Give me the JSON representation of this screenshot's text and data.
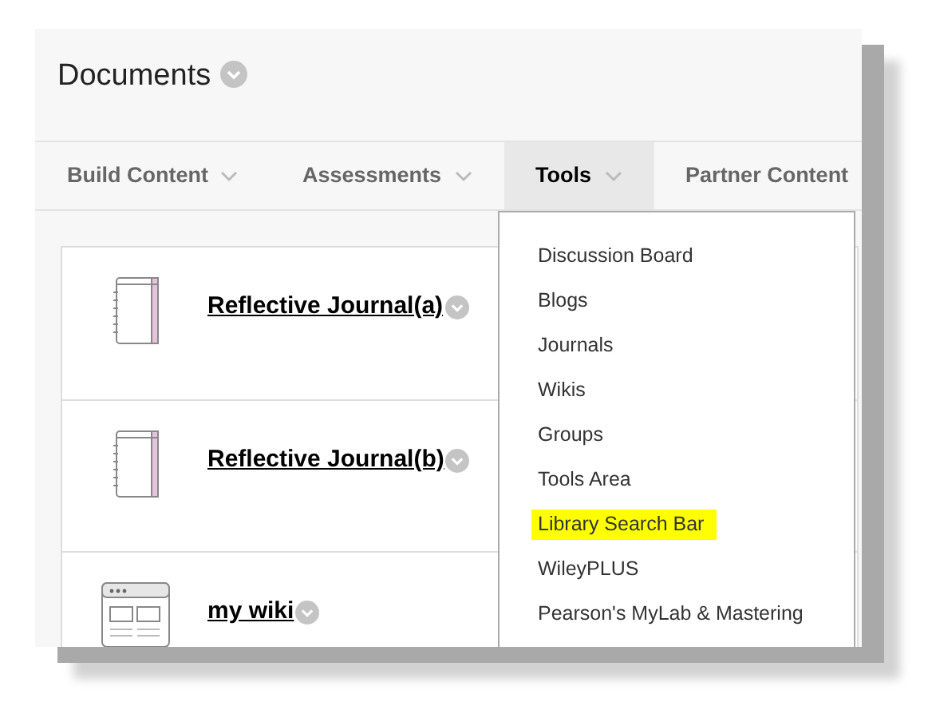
{
  "page": {
    "title": "Documents"
  },
  "tabs": [
    {
      "label": "Build Content",
      "selected": false
    },
    {
      "label": "Assessments",
      "selected": false
    },
    {
      "label": "Tools",
      "selected": true
    },
    {
      "label": "Partner Content",
      "selected": false
    }
  ],
  "items": [
    {
      "title": "Reflective Journal(a)",
      "kind": "journal"
    },
    {
      "title": "Reflective Journal(b)",
      "kind": "journal"
    },
    {
      "title": "my wiki",
      "kind": "wiki"
    }
  ],
  "menu": [
    {
      "label": "Discussion Board",
      "highlighted": false
    },
    {
      "label": "Blogs",
      "highlighted": false
    },
    {
      "label": "Journals",
      "highlighted": false
    },
    {
      "label": "Wikis",
      "highlighted": false
    },
    {
      "label": "Groups",
      "highlighted": false
    },
    {
      "label": "Tools Area",
      "highlighted": false
    },
    {
      "label": "Library Search Bar",
      "highlighted": true
    },
    {
      "label": "WileyPLUS",
      "highlighted": false
    },
    {
      "label": "Pearson's MyLab & Mastering",
      "highlighted": false
    }
  ]
}
